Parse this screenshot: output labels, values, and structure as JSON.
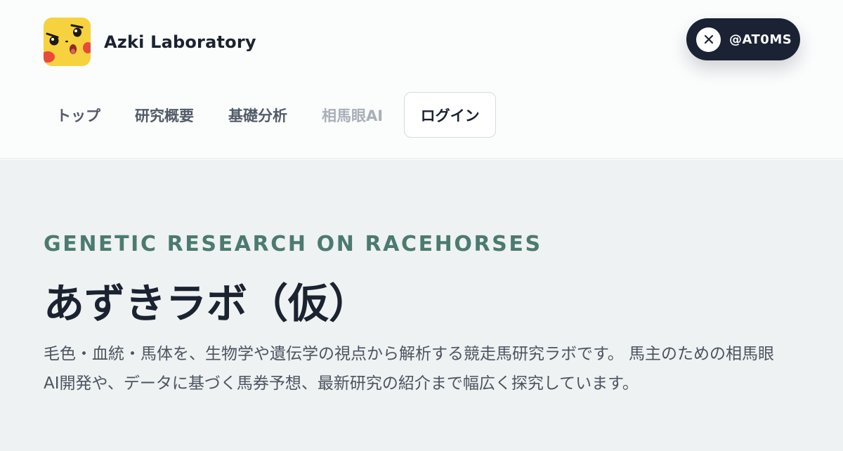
{
  "brand": {
    "name": "Azki Laboratory",
    "logo_icon": "pikachu-face-icon"
  },
  "social": {
    "icon": "x-logo-icon",
    "handle": "@AT0MS"
  },
  "nav": {
    "items": [
      {
        "label": "トップ",
        "state": "default"
      },
      {
        "label": "研究概要",
        "state": "default"
      },
      {
        "label": "基礎分析",
        "state": "default"
      },
      {
        "label": "相馬眼AI",
        "state": "muted"
      }
    ],
    "login_label": "ログイン"
  },
  "hero": {
    "eyebrow": "GENETIC RESEARCH ON RACEHORSES",
    "title": "あずきラボ（仮）",
    "description": "毛色・血統・馬体を、生物学や遺伝学の視点から解析する競走馬研究ラボです。 馬主のための相馬眼AI開発や、データに基づく馬券予想、最新研究の紹介まで幅広く探究しています。"
  },
  "colors": {
    "accent": "#4c7a70",
    "dark": "#1b2230",
    "badge_bg": "#1a2233",
    "hero_bg": "#eef2f2",
    "muted_text": "#a9afb7"
  }
}
